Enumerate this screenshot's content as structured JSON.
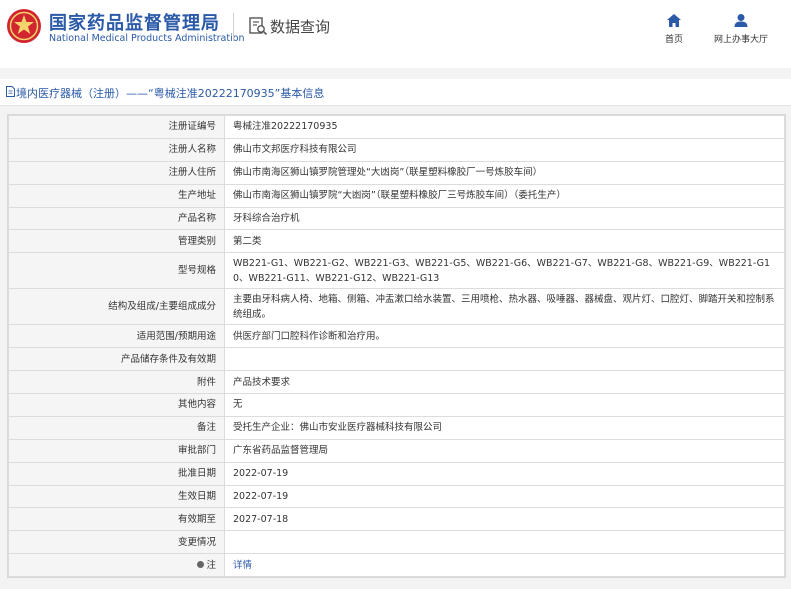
{
  "header": {
    "brand_cn": "国家药品监督管理局",
    "brand_en": "National Medical Products Administration",
    "query_title": "数据查询",
    "nav": [
      {
        "label": "首页",
        "icon": "home-icon"
      },
      {
        "label": "网上办事大厅",
        "icon": "user-icon"
      }
    ],
    "brand_color": "#2a5aa8",
    "logo_color": "#d1252f"
  },
  "title_bar": {
    "text": "境内医疗器械（注册）——“粤械注准20222170935”基本信息"
  },
  "table": {
    "rows": [
      {
        "label": "注册证编号",
        "value": "粤械注准20222170935"
      },
      {
        "label": "注册人名称",
        "value": "佛山市文邦医疗科技有限公司"
      },
      {
        "label": "注册人住所",
        "value": "佛山市南海区狮山镇罗院管理处“大凼岗”（联星塑料橡胶厂一号炼胶车间）"
      },
      {
        "label": "生产地址",
        "value": "佛山市南海区狮山镇罗院“大凼岗”（联星塑料橡胶厂三号炼胶车间）（委托生产）"
      },
      {
        "label": "产品名称",
        "value": "牙科综合治疗机"
      },
      {
        "label": "管理类别",
        "value": "第二类"
      },
      {
        "label": "型号规格",
        "value": "WB221-G1、WB221-G2、WB221-G3、WB221-G5、WB221-G6、WB221-G7、WB221-G8、WB221-G9、WB221-G10、WB221-G11、WB221-G12、WB221-G13"
      },
      {
        "label": "结构及组成/主要组成成分",
        "value": "主要由牙科病人椅、地箱、侧箱、冲盂漱口给水装置、三用喷枪、热水器、吸唾器、器械盘、观片灯、口腔灯、脚踏开关和控制系统组成。"
      },
      {
        "label": "适用范围/预期用途",
        "value": "供医疗部门口腔科作诊断和治疗用。"
      },
      {
        "label": "产品储存条件及有效期",
        "value": ""
      },
      {
        "label": "附件",
        "value": "产品技术要求"
      },
      {
        "label": "其他内容",
        "value": "无"
      },
      {
        "label": "备注",
        "value": "受托生产企业：佛山市安业医疗器械科技有限公司"
      },
      {
        "label": "审批部门",
        "value": "广东省药品监督管理局"
      },
      {
        "label": "批准日期",
        "value": "2022-07-19"
      },
      {
        "label": "生效日期",
        "value": "2022-07-19"
      },
      {
        "label": "有效期至",
        "value": "2027-07-18"
      },
      {
        "label": "变更情况",
        "value": ""
      },
      {
        "label": "注",
        "value": "详情"
      }
    ]
  }
}
